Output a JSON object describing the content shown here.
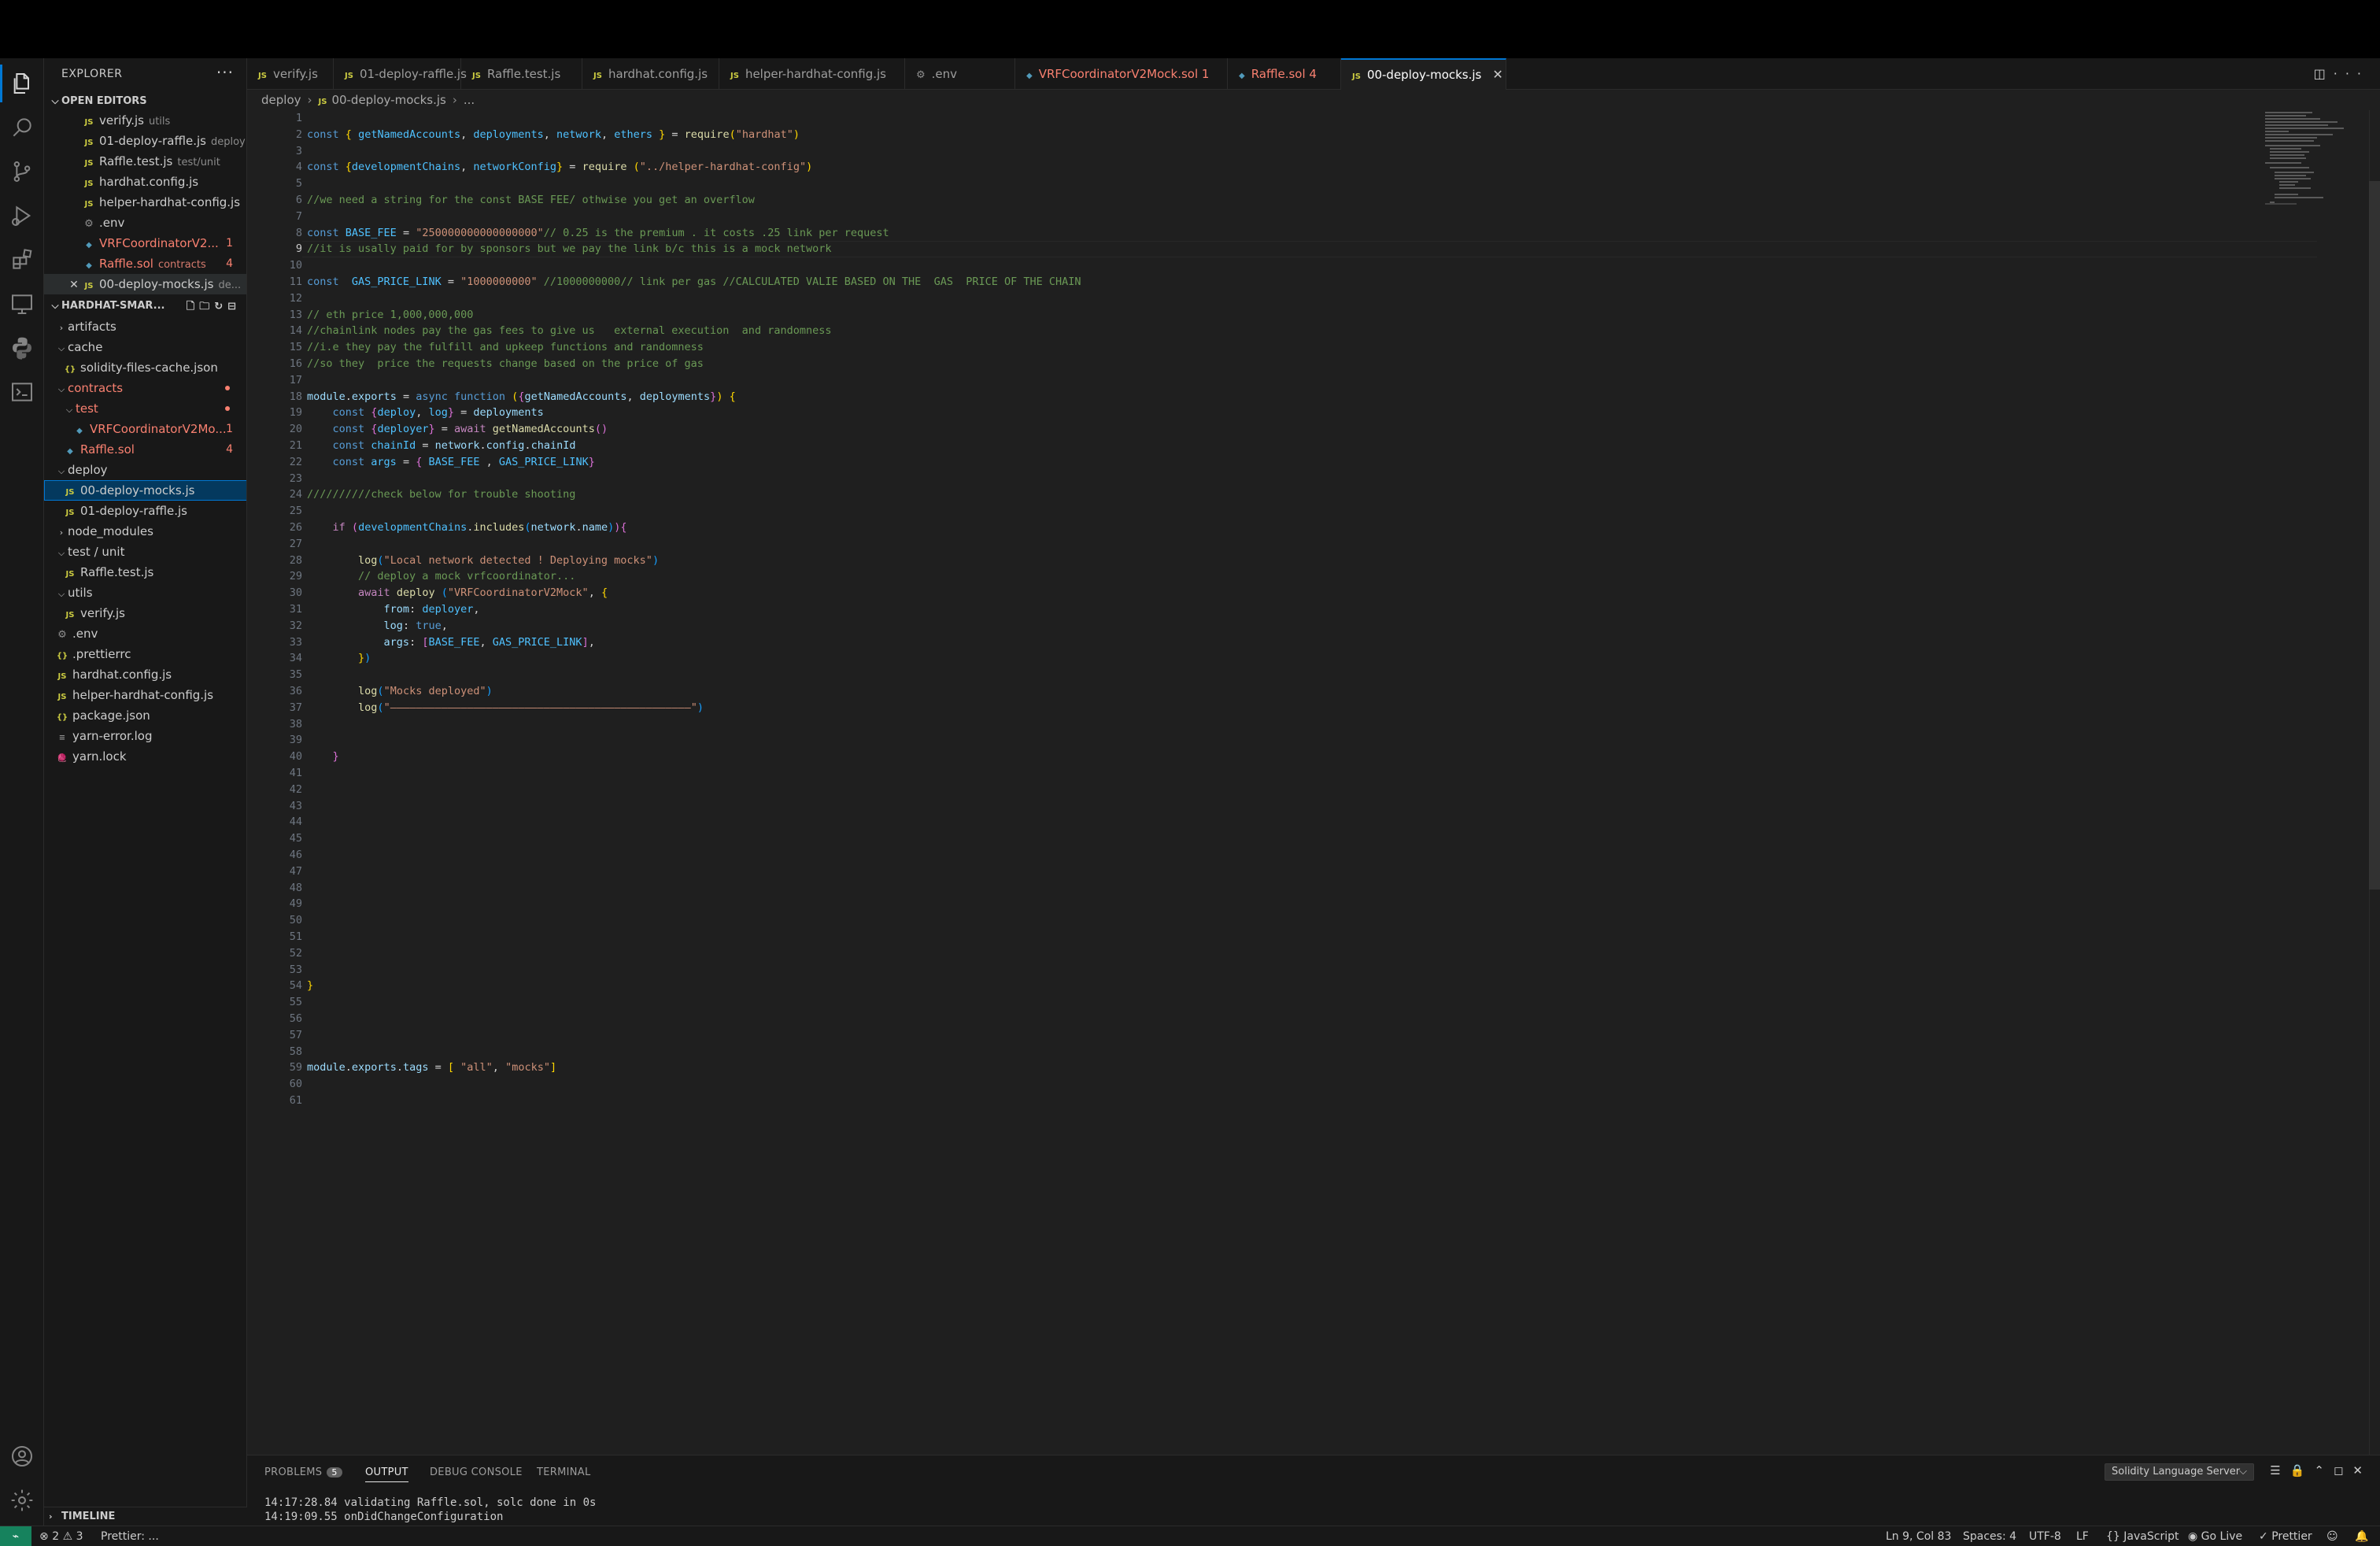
{
  "sidebar": {
    "title": "EXPLORER",
    "open_editors_label": "OPEN EDITORS",
    "open_editors": [
      {
        "label": "verify.js",
        "desc": "utils",
        "kind": "js"
      },
      {
        "label": "01-deploy-raffle.js",
        "desc": "deploy",
        "kind": "js"
      },
      {
        "label": "Raffle.test.js",
        "desc": "test/unit",
        "kind": "js"
      },
      {
        "label": "hardhat.config.js",
        "desc": "",
        "kind": "js"
      },
      {
        "label": "helper-hardhat-config.js",
        "desc": "",
        "kind": "js"
      },
      {
        "label": ".env",
        "desc": "",
        "kind": "gear"
      },
      {
        "label": "VRFCoordinatorV2...",
        "desc": "",
        "kind": "sol",
        "badge": "1"
      },
      {
        "label": "Raffle.sol",
        "desc": "contracts",
        "kind": "sol",
        "badge": "4"
      },
      {
        "label": "00-deploy-mocks.js",
        "desc": "de...",
        "kind": "js"
      }
    ],
    "project_label": "HARDHAT-SMAR...",
    "tree": [
      {
        "label": "artifacts"
      },
      {
        "label": "cache"
      },
      {
        "label": "solidity-files-cache.json"
      },
      {
        "label": "contracts"
      },
      {
        "label": "test"
      },
      {
        "label": "VRFCoordinatorV2Mo...",
        "badge": "1"
      },
      {
        "label": "Raffle.sol",
        "badge": "4"
      },
      {
        "label": "deploy"
      },
      {
        "label": "00-deploy-mocks.js"
      },
      {
        "label": "01-deploy-raffle.js"
      },
      {
        "label": "node_modules"
      },
      {
        "label": "test / unit"
      },
      {
        "label": "Raffle.test.js"
      },
      {
        "label": "utils"
      },
      {
        "label": "verify.js"
      },
      {
        "label": ".env"
      },
      {
        "label": ".prettierrc"
      },
      {
        "label": "hardhat.config.js"
      },
      {
        "label": "helper-hardhat-config.js"
      },
      {
        "label": "package.json"
      },
      {
        "label": "yarn-error.log"
      },
      {
        "label": "yarn.lock"
      }
    ],
    "timeline_label": "TIMELINE"
  },
  "tabs": [
    {
      "label": "verify.js"
    },
    {
      "label": "01-deploy-raffle.js"
    },
    {
      "label": "Raffle.test.js"
    },
    {
      "label": "hardhat.config.js"
    },
    {
      "label": "helper-hardhat-config.js"
    },
    {
      "label": ".env"
    },
    {
      "label": "VRFCoordinatorV2Mock.sol 1"
    },
    {
      "label": "Raffle.sol 4"
    },
    {
      "label": "00-deploy-mocks.js"
    }
  ],
  "breadcrumb": {
    "folder": "deploy",
    "file": "00-deploy-mocks.js",
    "more": "..."
  },
  "editor": {
    "line_count": 61,
    "current_line": 9
  },
  "panel": {
    "tabs": [
      "PROBLEMS",
      "OUTPUT",
      "DEBUG CONSOLE",
      "TERMINAL"
    ],
    "problems_count": "5",
    "channel": "Solidity Language Server",
    "lines": [
      "14:17:28.84 validating Raffle.sol, solc done in 0s",
      "14:19:09.55 onDidChangeConfiguration"
    ]
  },
  "status": {
    "errors": "2",
    "warnings": "3",
    "prettier_left": "Prettier: ...",
    "position": "Ln 9, Col 83",
    "spaces": "Spaces: 4",
    "encoding": "UTF-8",
    "eol": "LF",
    "language": "JavaScript",
    "go_live": "Go Live",
    "prettier": "Prettier"
  },
  "colors": {
    "accent": "#0078d4",
    "error": "#f88070",
    "remote": "#16825d"
  }
}
